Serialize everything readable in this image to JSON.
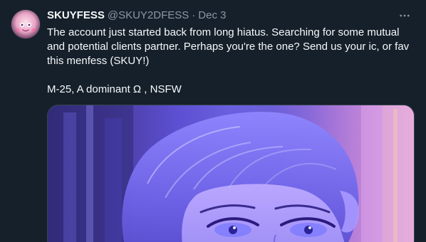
{
  "tweet": {
    "display_name": "SKUYFESS",
    "handle": "@SKUY2DFESS",
    "separator": "·",
    "time": "Dec 3",
    "body_line1": "The account just started back from long hiatus. Searching for some mutual and potential clients partner. Perhaps you're the one? Send us your ic, or fav this menfess (SKUY!)",
    "body_line2": "M-25, A dominant Ω , NSFW"
  },
  "icons": {
    "more": "more-options-icon",
    "avatar": "avatar-icon"
  },
  "colors": {
    "background": "#15202b",
    "text_primary": "#f7f9f9",
    "text_secondary": "#8b98a5",
    "border": "#38444d"
  }
}
